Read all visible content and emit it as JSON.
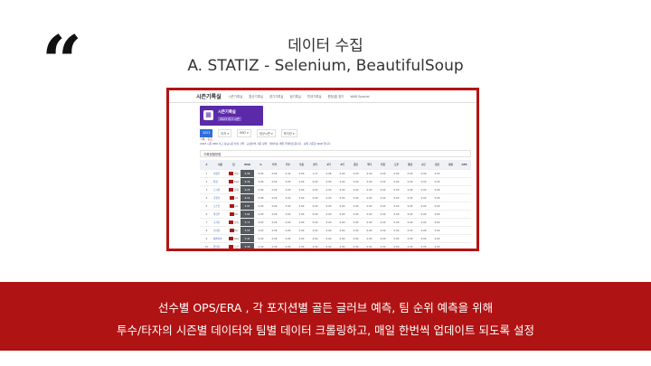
{
  "quote_mark": "“",
  "heading": {
    "line1": "데이터 수집",
    "line2": "A. STATIZ - Selenium, BeautifulSoup"
  },
  "screenshot": {
    "site_title": "시즌기록실",
    "nav_items": [
      "시즌기록실",
      "통산기록실",
      "경기기록실",
      "팀기록실",
      "투대기록실",
      "원정/홈 경기",
      "WAR Special"
    ],
    "hero_title": "시즌기록실",
    "hero_sub": "2023 리그 시즌",
    "filters": [
      {
        "label": "2023",
        "active": true
      },
      {
        "label": "타자 ▾",
        "active": false
      },
      {
        "label": "KBO ▾",
        "active": false
      },
      {
        "label": "정규시즌 ▾",
        "active": false
      },
      {
        "label": "포지션 ▾",
        "active": false
      }
    ],
    "links_row": "기록 · 주요",
    "notice": "2023 시즌 KBO 리그 정규시즌 타자 기록 · 규정타석 기준 정렬 · 데이터는 매일 업데이트됩니다 · 순위 기준은 WAR 입니다",
    "table_title": "기록정렬방법",
    "columns": [
      "#",
      "이름",
      "팀",
      "WAR",
      "G",
      "타석",
      "타수",
      "득점",
      "안타",
      "2타",
      "3타",
      "홈런",
      "루타",
      "타점",
      "도루",
      "볼넷",
      "사구",
      "삼진",
      "병살",
      "OPS"
    ],
    "rows": [
      [
        "1",
        "이정후",
        "키움",
        "6.98",
        "0.80",
        "0.00",
        "0.32",
        "0.00",
        "1.27",
        "0.08",
        "0.00",
        "0.00",
        "0.00",
        "0.00",
        "0.00",
        "0.00",
        "0.00",
        "0.00"
      ],
      [
        "2",
        "최정",
        "SSG",
        "6.36",
        "0.86",
        "0.00",
        "0.00",
        "0.00",
        "0.00",
        "0.00",
        "0.00",
        "0.00",
        "0.00",
        "0.00",
        "0.00",
        "0.00",
        "0.00",
        "0.00"
      ],
      [
        "3",
        "노시환",
        "한화",
        "6.28",
        "0.90",
        "0.00",
        "0.00",
        "0.00",
        "0.00",
        "0.00",
        "0.00",
        "0.00",
        "0.00",
        "0.00",
        "0.00",
        "0.00",
        "0.00",
        "0.00"
      ],
      [
        "4",
        "홍창기",
        "LG",
        "6.12",
        "0.88",
        "0.00",
        "0.00",
        "0.00",
        "0.00",
        "0.00",
        "0.00",
        "0.00",
        "0.00",
        "0.00",
        "0.00",
        "0.00",
        "0.00",
        "0.00"
      ],
      [
        "5",
        "오스틴",
        "LG",
        "5.97",
        "0.00",
        "0.00",
        "0.00",
        "0.00",
        "0.00",
        "0.00",
        "0.00",
        "0.00",
        "0.00",
        "0.00",
        "0.00",
        "0.00",
        "0.00",
        "0.00"
      ],
      [
        "6",
        "박건우",
        "NC",
        "5.84",
        "0.00",
        "0.00",
        "0.00",
        "0.00",
        "0.00",
        "0.00",
        "0.00",
        "0.00",
        "0.00",
        "0.00",
        "0.00",
        "0.00",
        "0.00",
        "0.00"
      ],
      [
        "7",
        "구자욱",
        "삼성",
        "5.71",
        "0.00",
        "0.00",
        "0.00",
        "0.00",
        "0.00",
        "0.00",
        "0.00",
        "0.00",
        "0.00",
        "0.00",
        "0.00",
        "0.00",
        "0.00",
        "0.00"
      ],
      [
        "8",
        "손아섭",
        "NC",
        "5.55",
        "0.00",
        "0.00",
        "0.00",
        "0.00",
        "0.00",
        "0.00",
        "0.00",
        "0.00",
        "0.00",
        "0.00",
        "0.00",
        "0.00",
        "0.00",
        "0.00"
      ],
      [
        "9",
        "에레디아",
        "SSG",
        "5.42",
        "0.00",
        "0.00",
        "0.00",
        "0.00",
        "0.00",
        "0.00",
        "0.00",
        "0.00",
        "0.00",
        "0.00",
        "0.00",
        "0.00",
        "0.00",
        "0.00"
      ],
      [
        "10",
        "양의지",
        "두산",
        "5.30",
        "0.00",
        "0.00",
        "0.00",
        "0.00",
        "0.00",
        "0.00",
        "0.00",
        "0.00",
        "0.00",
        "0.00",
        "0.00",
        "0.00",
        "0.00",
        "0.00"
      ]
    ]
  },
  "band": {
    "line1": "선수별 OPS/ERA , 각 포지션별 골든 글러브 예측, 팀 순위 예측을 위해",
    "line2": "투수/타자의 시즌별 데이터와 팀별 데이터 크롤링하고, 매일 한번씩 업데이트 되도록 설정"
  },
  "colors": {
    "accent_red": "#b01313",
    "hero_purple": "#5b2aa8"
  }
}
